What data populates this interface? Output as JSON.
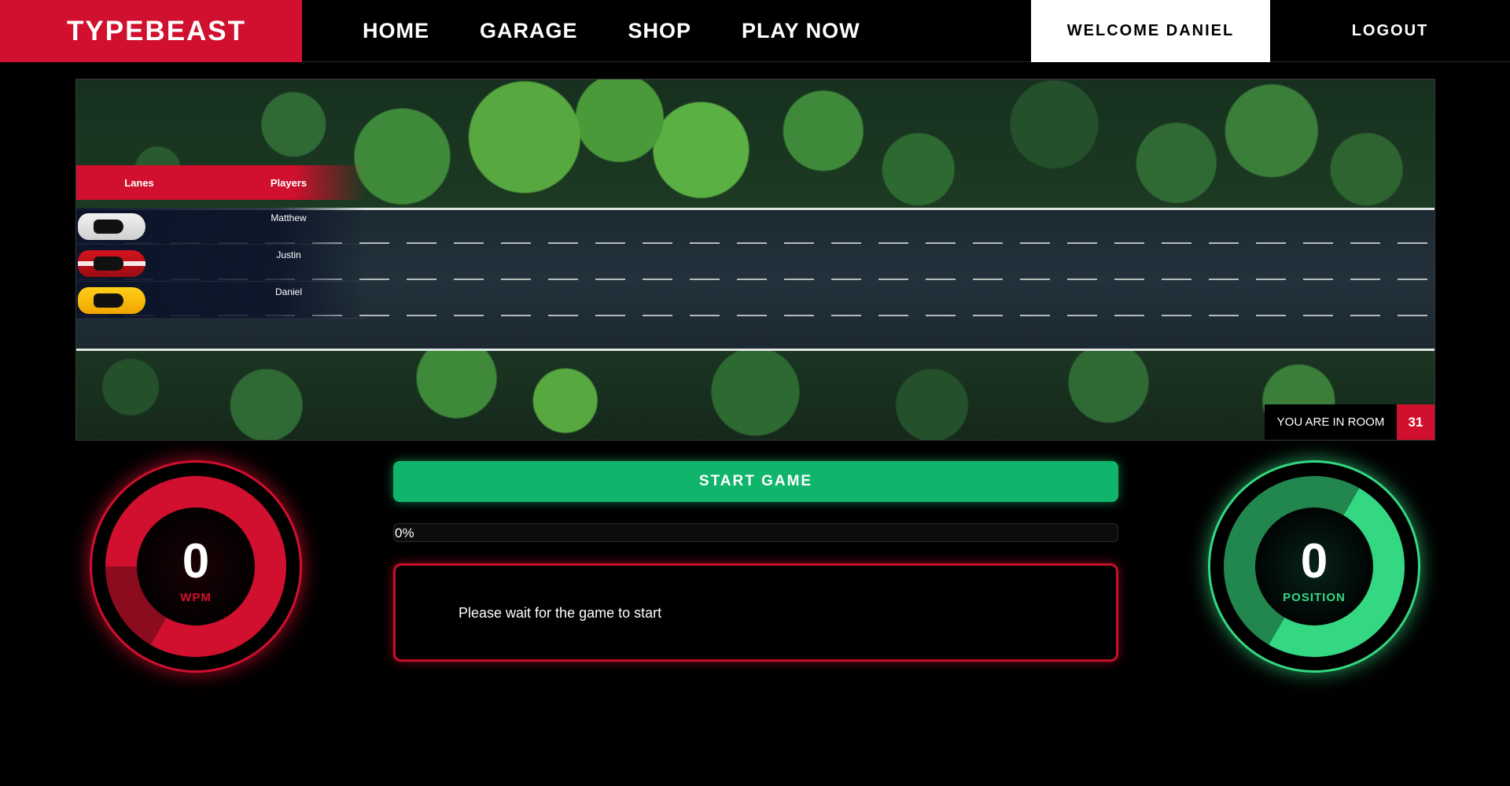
{
  "nav": {
    "logo": "TYPEBEAST",
    "items": [
      "HOME",
      "GARAGE",
      "SHOP",
      "PLAY NOW"
    ],
    "welcome": "WELCOME DANIEL",
    "logout": "LOGOUT"
  },
  "race": {
    "lanes_header": "Lanes",
    "players_header": "Players",
    "players": [
      {
        "name": "Matthew",
        "car": "white-car-icon"
      },
      {
        "name": "Justin",
        "car": "red-car-icon"
      },
      {
        "name": "Daniel",
        "car": "yellow-car-icon"
      }
    ],
    "room_label": "YOU ARE IN ROOM",
    "room_number": "31"
  },
  "stats": {
    "wpm_value": "0",
    "wpm_label": "WPM",
    "position_value": "0",
    "position_label": "POSITION"
  },
  "controls": {
    "start_label": "START GAME",
    "progress_text": "0%",
    "progress_fraction": 0,
    "message": "Please wait for the game to start"
  },
  "colors": {
    "brand_red": "#d10f2e",
    "accent_green": "#10b46a",
    "position_green": "#34d882"
  }
}
